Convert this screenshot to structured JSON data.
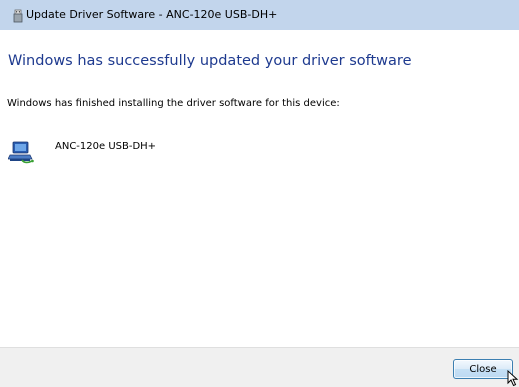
{
  "window": {
    "title": "Update Driver Software - ANC-120e USB-DH+"
  },
  "main": {
    "heading": "Windows has successfully updated your driver software",
    "subtext": "Windows has finished installing the driver software for this device:",
    "device_name": "ANC-120e USB-DH+"
  },
  "footer": {
    "close_label": "Close"
  },
  "icons": {
    "title_icon": "usb-driver-icon",
    "device_icon": "network-device-icon",
    "cursor": "mouse-pointer-icon"
  },
  "colors": {
    "titlebar": "#c2d5ec",
    "heading": "#1e3a8f",
    "footer": "#f0f0f0",
    "button_border": "#3c7fb1"
  }
}
